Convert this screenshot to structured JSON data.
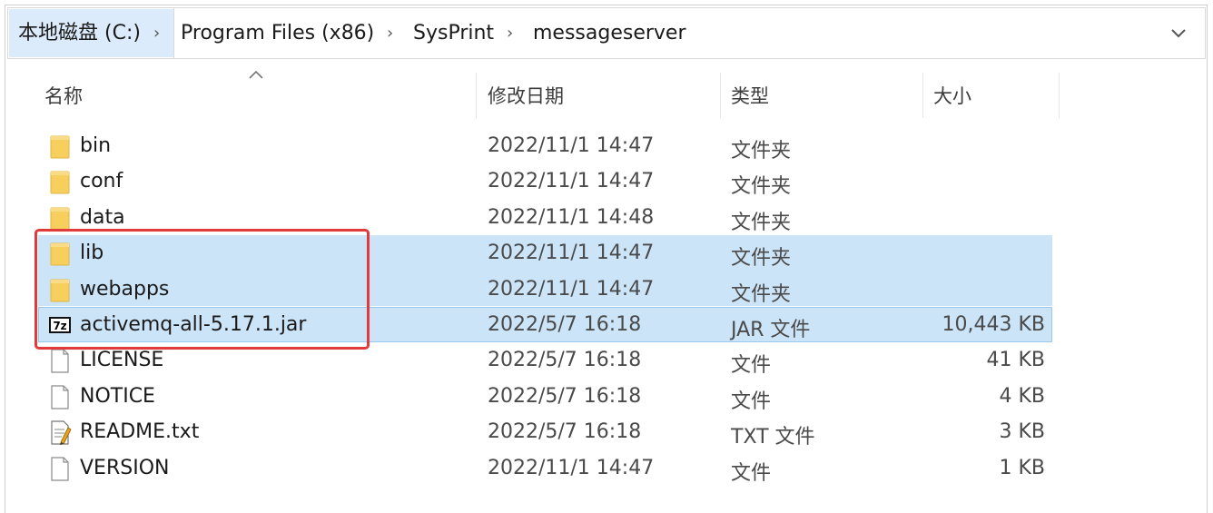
{
  "breadcrumb": {
    "items": [
      "本地磁盘 (C:)",
      "Program Files (x86)",
      "SysPrint",
      "messageserver"
    ]
  },
  "columns": {
    "name": "名称",
    "date": "修改日期",
    "type": "类型",
    "size": "大小"
  },
  "files": [
    {
      "name": "bin",
      "date": "2022/11/1 14:47",
      "type": "文件夹",
      "size": "",
      "icon": "folder-icon",
      "selected": false
    },
    {
      "name": "conf",
      "date": "2022/11/1 14:47",
      "type": "文件夹",
      "size": "",
      "icon": "folder-icon",
      "selected": false
    },
    {
      "name": "data",
      "date": "2022/11/1 14:48",
      "type": "文件夹",
      "size": "",
      "icon": "folder-icon",
      "selected": false
    },
    {
      "name": "lib",
      "date": "2022/11/1 14:47",
      "type": "文件夹",
      "size": "",
      "icon": "folder-icon",
      "selected": true
    },
    {
      "name": "webapps",
      "date": "2022/11/1 14:47",
      "type": "文件夹",
      "size": "",
      "icon": "folder-icon",
      "selected": true
    },
    {
      "name": "activemq-all-5.17.1.jar",
      "date": "2022/5/7 16:18",
      "type": "JAR 文件",
      "size": "10,443 KB",
      "icon": "7z-archive-icon",
      "selected": true
    },
    {
      "name": "LICENSE",
      "date": "2022/5/7 16:18",
      "type": "文件",
      "size": "41 KB",
      "icon": "file-icon",
      "selected": false
    },
    {
      "name": "NOTICE",
      "date": "2022/5/7 16:18",
      "type": "文件",
      "size": "4 KB",
      "icon": "file-icon",
      "selected": false
    },
    {
      "name": "README.txt",
      "date": "2022/5/7 16:18",
      "type": "TXT 文件",
      "size": "3 KB",
      "icon": "text-file-icon",
      "selected": false
    },
    {
      "name": "VERSION",
      "date": "2022/11/1 14:47",
      "type": "文件",
      "size": "1 KB",
      "icon": "file-icon",
      "selected": false
    }
  ],
  "icons": {
    "archive_badge": "7z"
  },
  "colors": {
    "selection": "#cce4f7",
    "highlight_box": "#e03a3a",
    "folder": "#f7cf5e"
  }
}
